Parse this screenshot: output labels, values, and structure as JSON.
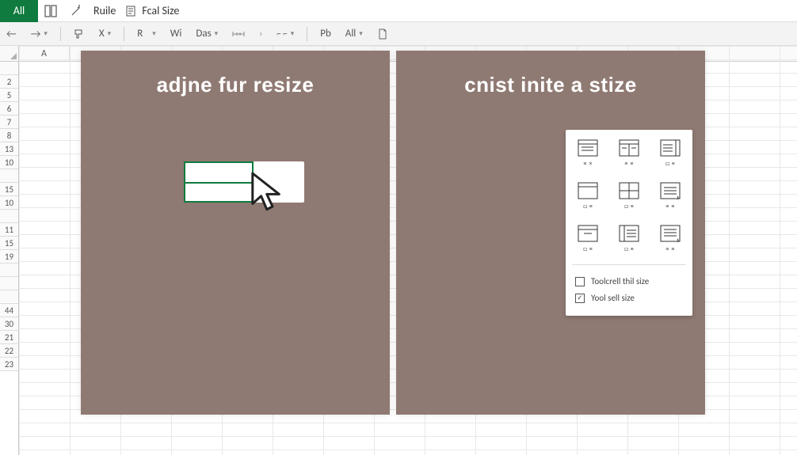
{
  "titlebar": {
    "all_btn": "All",
    "ruile": "Ruile",
    "fcal_size": "Fcal Size"
  },
  "toolbar": {
    "r": "R",
    "wi": "Wi",
    "das": "Das",
    "pb": "Pb",
    "all": "All",
    "x": "X"
  },
  "col_headers": [
    "A"
  ],
  "row_headers": [
    "",
    "2",
    "5",
    "6",
    "7",
    "8",
    "13",
    "10",
    "",
    "15",
    "10",
    "",
    "11",
    "15",
    "19",
    "",
    "",
    "",
    "44",
    "30",
    "21",
    "22",
    "23"
  ],
  "panels": {
    "left_title": "adjne fur resize",
    "right_title": "cnist inite a stize"
  },
  "popup": {
    "icons": [
      {
        "name": "icon-1"
      },
      {
        "name": "icon-2"
      },
      {
        "name": "icon-3"
      },
      {
        "name": "icon-4"
      },
      {
        "name": "icon-5"
      },
      {
        "name": "icon-6"
      },
      {
        "name": "icon-7"
      },
      {
        "name": "icon-8"
      },
      {
        "name": "icon-9"
      }
    ],
    "row1": "Toolcrell thil size",
    "row2": "Yool sell size"
  }
}
